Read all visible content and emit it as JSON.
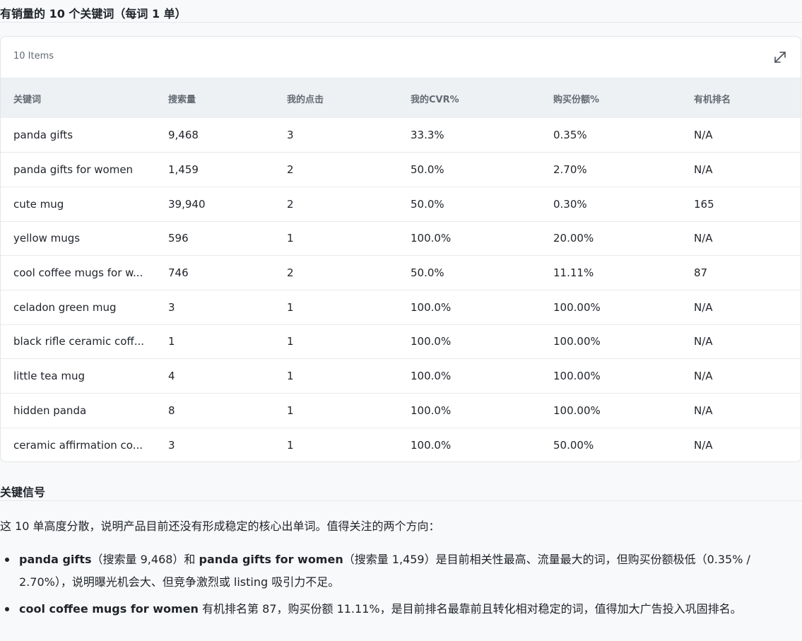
{
  "section1": {
    "title": "有销量的 10 个关键词（每词 1 单）"
  },
  "table": {
    "items_count": "10 Items",
    "expand_icon": "expand-icon",
    "columns": [
      "关键词",
      "搜索量",
      "我的点击",
      "我的CVR%",
      "购买份额%",
      "有机排名"
    ],
    "rows": [
      [
        "panda gifts",
        "9,468",
        "3",
        "33.3%",
        "0.35%",
        "N/A"
      ],
      [
        "panda gifts for women",
        "1,459",
        "2",
        "50.0%",
        "2.70%",
        "N/A"
      ],
      [
        "cute mug",
        "39,940",
        "2",
        "50.0%",
        "0.30%",
        "165"
      ],
      [
        "yellow mugs",
        "596",
        "1",
        "100.0%",
        "20.00%",
        "N/A"
      ],
      [
        "cool coffee mugs for w...",
        "746",
        "2",
        "50.0%",
        "11.11%",
        "87"
      ],
      [
        "celadon green mug",
        "3",
        "1",
        "100.0%",
        "100.00%",
        "N/A"
      ],
      [
        "black rifle ceramic coff...",
        "1",
        "1",
        "100.0%",
        "100.00%",
        "N/A"
      ],
      [
        "little tea mug",
        "4",
        "1",
        "100.0%",
        "100.00%",
        "N/A"
      ],
      [
        "hidden panda",
        "8",
        "1",
        "100.0%",
        "100.00%",
        "N/A"
      ],
      [
        "ceramic affirmation co...",
        "3",
        "1",
        "100.0%",
        "50.00%",
        "N/A"
      ]
    ]
  },
  "section2": {
    "title": "关键信号",
    "paragraph": "这 10 单高度分散，说明产品目前还没有形成稳定的核心出单词。值得关注的两个方向：",
    "bullets": [
      {
        "b1": "panda gifts",
        "t1": "（搜索量 9,468）和 ",
        "b2": "panda gifts for women",
        "t2": "（搜索量 1,459）是目前相关性最高、流量最大的词，但购买份额极低（0.35% / 2.70%），说明曝光机会大、但竞争激烈或 listing 吸引力不足。"
      },
      {
        "b1": "cool coffee mugs for women",
        "t1": " 有机排名第 87，购买份额 11.11%，是目前排名最靠前且转化相对稳定的词，值得加大广告投入巩固排名。"
      }
    ]
  }
}
